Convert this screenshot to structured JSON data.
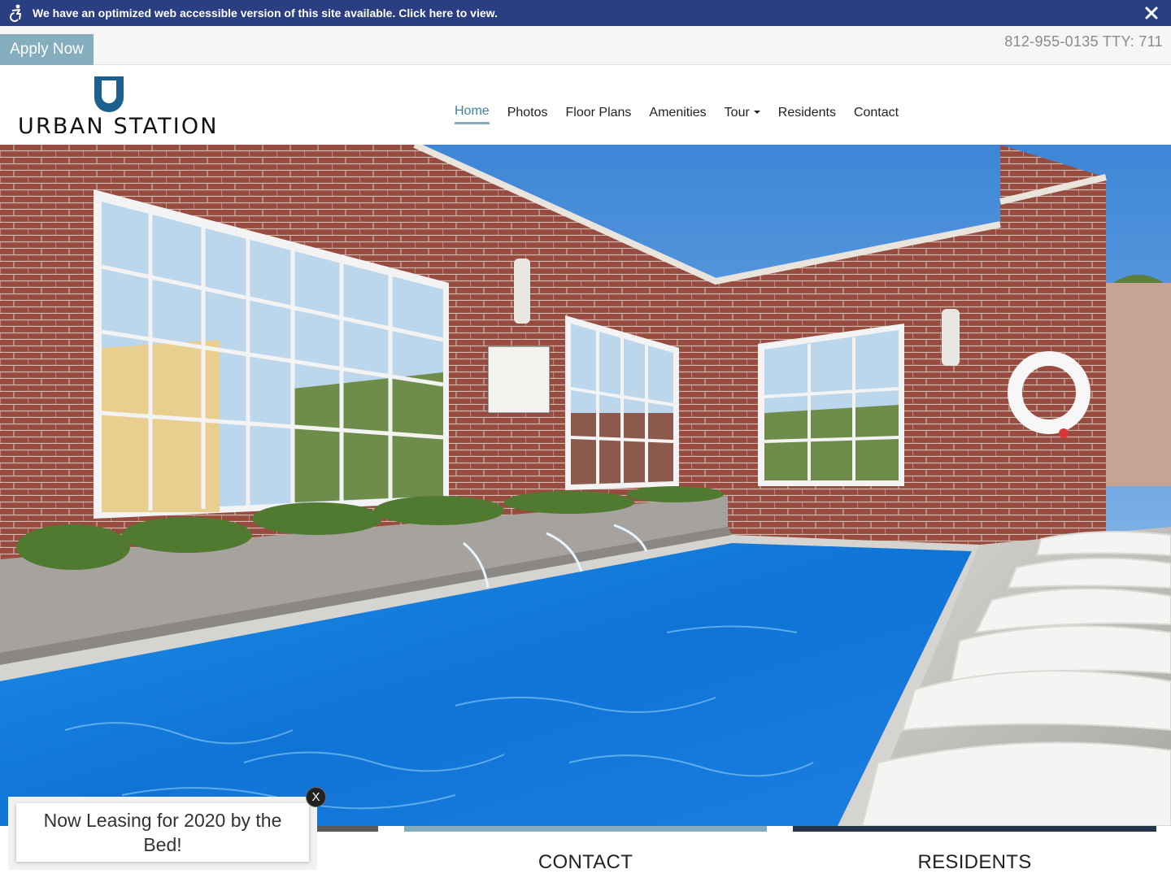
{
  "accessibility_bar": {
    "text": "We have an optimized web accessible version of this site available. Click here to view.",
    "icon": "accessibility-icon",
    "close_icon": "close-icon",
    "background": "#2a3f82"
  },
  "top_strip": {
    "apply_label": "Apply Now",
    "phone": "812-955-0135 TTY: 711",
    "apply_color": "#84adbd"
  },
  "logo": {
    "text": "URBAN STATION",
    "mark_icon": "u-shield-logo-icon",
    "mark_color": "#1d5f8f"
  },
  "nav": {
    "items": [
      {
        "label": "Home",
        "active": true
      },
      {
        "label": "Photos"
      },
      {
        "label": "Floor Plans"
      },
      {
        "label": "Amenities"
      },
      {
        "label": "Tour",
        "dropdown": true
      },
      {
        "label": "Residents"
      },
      {
        "label": "Contact"
      }
    ],
    "active_color": "#3d7fa6"
  },
  "bottom_tiles": [
    {
      "label": "",
      "color": "#5a5a5a"
    },
    {
      "label": "CONTACT",
      "color": "#84adbd"
    },
    {
      "label": "RESIDENTS",
      "color": "#26364a"
    }
  ],
  "popup": {
    "text": "Now Leasing for 2020 by the Bed!",
    "close_label": "X"
  }
}
